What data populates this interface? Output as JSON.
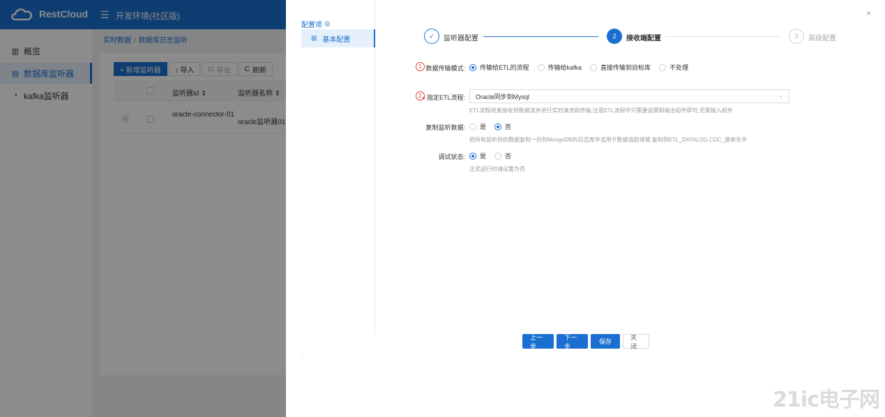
{
  "app": {
    "logo_text": "RestCloud",
    "env_label": "开发环境(社区版)"
  },
  "sidebar": {
    "items": [
      {
        "label": "概览",
        "icon": "bar-chart-icon"
      },
      {
        "label": "数据库监听器",
        "icon": "database-icon"
      },
      {
        "label": "kafka监听器",
        "icon": "headset-icon"
      }
    ]
  },
  "breadcrumb": {
    "root": "实时数据",
    "current": "数据库日志监听"
  },
  "toolbar": {
    "add": "+ 新增监听器",
    "import": "↑ 导入",
    "export": "导出",
    "refresh": "刷新"
  },
  "table": {
    "columns": [
      "监听器Id",
      "监听器名称"
    ],
    "rows": [
      {
        "id": "oracle-connector-01",
        "name": "oracle监听器01"
      }
    ]
  },
  "drawer": {
    "left_title": "配置项",
    "left_item": "基本配置",
    "colon": ":",
    "close": "×"
  },
  "steps": [
    {
      "num": "✓",
      "label": "监听器配置",
      "state": "done"
    },
    {
      "num": "2",
      "label": "接收端配置",
      "state": "active"
    },
    {
      "num": "3",
      "label": "高级配置",
      "state": "wait"
    }
  ],
  "form": {
    "mode": {
      "marker": "1",
      "label": "数据传输模式:",
      "options": [
        "传输给ETL的流程",
        "传输给kafka",
        "直接传输到目标库",
        "不处理"
      ],
      "selected": 0
    },
    "etl": {
      "marker": "2",
      "label": "指定ETL流程:",
      "value": "Oracle同步到Mysql",
      "hint": "ETL流程将直接收到数据流并进行实时清洗和传输,注意ETL流程中只需要运算和输出组件即可,无需输入组件"
    },
    "copy": {
      "label": "复制监听数据:",
      "options": [
        "是",
        "否"
      ],
      "selected": 1,
      "hint": "把所有监听到的数据复制一份到MongoDB的日志库中适用于数据追踪排错,复制到ETL_DATALOG.CDC_源表名中"
    },
    "debug": {
      "label": "调试状态:",
      "options": [
        "是",
        "否"
      ],
      "selected": 0,
      "hint": "正式运行时请设置为否"
    }
  },
  "buttons": {
    "prev": "上一步",
    "next": "下一步",
    "save": "保存",
    "close": "关 闭"
  },
  "watermark": "21ic电子网"
}
